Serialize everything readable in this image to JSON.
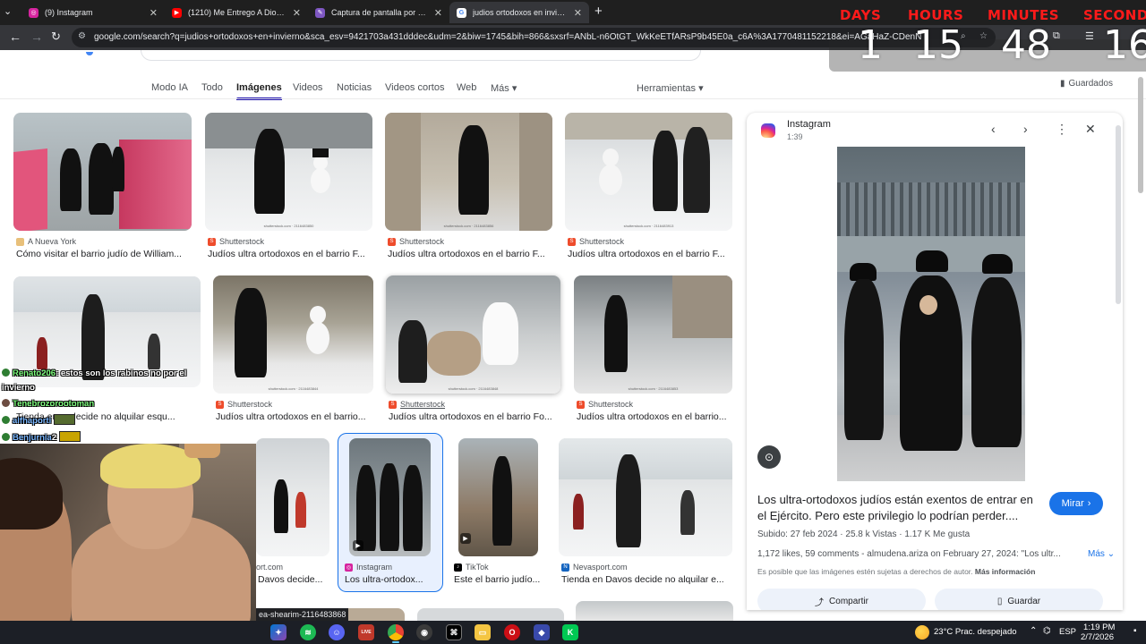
{
  "browser": {
    "tabs": [
      {
        "title": "(9) Instagram",
        "favicon": "instagram-icon",
        "color": "#d6249f"
      },
      {
        "title": "(1210) Me Entrego A Dios - Kal",
        "favicon": "youtube-icon",
        "color": "#ff0000"
      },
      {
        "title": "Captura de pantalla por Lightsh",
        "favicon": "lightshot-icon",
        "color": "#7e57c2"
      },
      {
        "title": "judios ortodoxos en invierno - B",
        "favicon": "google-icon",
        "color": "#4285f4"
      }
    ],
    "url": "google.com/search?q=judios+ortodoxos+en+invierno&sca_esv=9421703a431dddec&udm=2&biw=1745&bih=866&sxsrf=ANbL-n6OtGT_WkKeETfARsP9b45E0a_c6A%3A1770481152218&ei=AGaHaZ-CDenN"
  },
  "countdown": {
    "labels": [
      "DAYS",
      "HOURS",
      "MINUTES",
      "SECONDS"
    ],
    "values": [
      "1",
      "15",
      "48",
      "16"
    ],
    "label_color": "#ff1a1a"
  },
  "google": {
    "tabs": [
      "Modo IA",
      "Todo",
      "Imágenes",
      "Videos",
      "Noticias",
      "Videos cortos",
      "Web",
      "Más"
    ],
    "active_tab": "Imágenes",
    "tools": "Herramientas",
    "saved": "Guardados"
  },
  "results": [
    {
      "source": "A Nueva York",
      "caption": "Cómo visitar el barrio judío de William..."
    },
    {
      "source": "Shutterstock",
      "caption": "Judíos ultra ortodoxos en el barrio F..."
    },
    {
      "source": "Shutterstock",
      "caption": "Judíos ultra ortodoxos en el barrio F..."
    },
    {
      "source": "Shutterstock",
      "caption": "Judíos ultra ortodoxos en el barrio F..."
    },
    {
      "source": "",
      "caption": "Tienda en ...   decide no alquilar esqu..."
    },
    {
      "source": "Shutterstock",
      "caption": "Judíos ultra ortodoxos en el barrio..."
    },
    {
      "source": "Shutterstock",
      "caption": "Judíos ultra ortodoxos en el barrio Fo..."
    },
    {
      "source": "Shutterstock",
      "caption": "Judíos ultra ortodoxos en el barrio..."
    },
    {
      "source": "ort.com",
      "caption": "Davos decide..."
    },
    {
      "source": "Instagram",
      "caption": "Los ultra-ortodox..."
    },
    {
      "source": "TikTok",
      "caption": "Este el barrio judío..."
    },
    {
      "source": "Nevasport.com",
      "caption": "Tienda en Davos decide no alquilar e..."
    }
  ],
  "watermarks": [
    "shutterstock.com · 2116483850",
    "shutterstock.com · 2116483856",
    "shutterstock.com · 2116483913",
    "shutterstock.com · 2116483844",
    "shutterstock.com · 2116483848",
    "shutterstock.com · 2116483853"
  ],
  "panel": {
    "source": "Instagram",
    "time": "1:39",
    "title": "Los ultra-ortodoxos judíos están exentos de entrar en el Ejército. Pero este privilegio lo podrían perder....",
    "watch": "Mirar",
    "meta": "Subido: 27 feb 2024 · 25.8 k Vistas · 1.17 K Me gusta",
    "desc": "1,172 likes, 59 comments - almudena.ariza on February 27, 2024: \"Los ultr...",
    "more": "Más",
    "notice": "Es posible que las imágenes estén sujetas a derechos de autor.",
    "notice_link": "Más información",
    "share": "Compartir",
    "save": "Guardar"
  },
  "chat": {
    "line1_nick": "Renato206",
    "line1_text": ": estos son los rabinos no por el",
    "line1_cont": "invierno",
    "line2_nick": "Tenebrozorootoman",
    "line3_nick": "alfhaporti",
    "line4_nick": "Benjurnia",
    "line4_text": "2"
  },
  "hover_tooltip": "ea-shearim-2116483868",
  "taskbar": {
    "weather": "23°C  Prac. despejado",
    "lang": "ESP",
    "time": "1:19 PM",
    "date": "2/7/2026"
  }
}
